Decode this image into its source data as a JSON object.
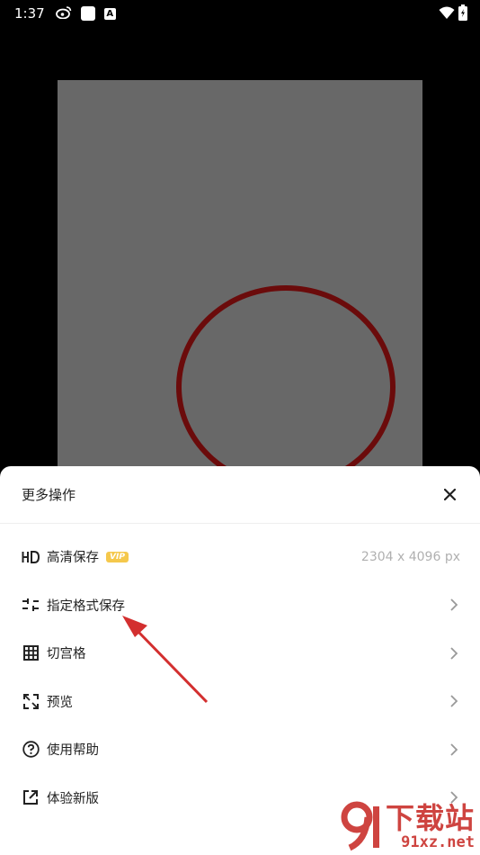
{
  "status_bar": {
    "time": "1:37",
    "a_badge": "A",
    "icons": [
      "weibo-icon",
      "notification-square-icon",
      "a-badge-icon",
      "wifi-icon",
      "battery-icon"
    ]
  },
  "preview": {
    "circle_color": "#6b0b0b",
    "background": "#686868"
  },
  "sheet": {
    "title": "更多操作",
    "items": [
      {
        "icon": "hd-icon",
        "label": "高清保存",
        "badge": "VIP",
        "value": "2304 x 4096 px"
      },
      {
        "icon": "format-sliders-icon",
        "label": "指定格式保存"
      },
      {
        "icon": "grid-icon",
        "label": "切宫格"
      },
      {
        "icon": "expand-icon",
        "label": "预览"
      },
      {
        "icon": "help-circle-icon",
        "label": "使用帮助"
      },
      {
        "icon": "external-link-icon",
        "label": "体验新版"
      }
    ]
  },
  "watermark": {
    "title": "下载站",
    "url": "91xz.net"
  },
  "colors": {
    "arrow": "#d32f2f",
    "vip": "#f5c84c"
  }
}
